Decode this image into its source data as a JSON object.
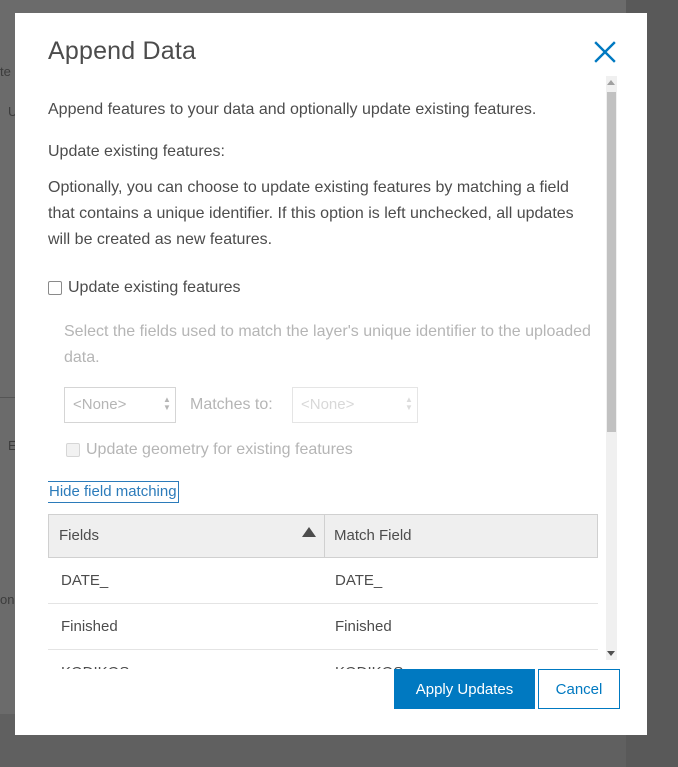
{
  "background": {
    "fragments": [
      "te",
      "U",
      "E",
      "on"
    ]
  },
  "dialog": {
    "title": "Append Data",
    "intro": "Append features to your data and optionally update existing features.",
    "subheading": "Update existing features:",
    "description": "Optionally, you can choose to update existing features by matching a field that contains a unique identifier. If this option is left unchecked, all updates will be created as new features.",
    "update_checkbox": {
      "label": "Update existing features",
      "checked": false
    },
    "select_hint": "Select the fields used to match the layer's unique identifier to the uploaded data.",
    "left_select": {
      "value": "<None>"
    },
    "matches_label": "Matches to:",
    "right_select": {
      "value": "<None>"
    },
    "geometry_checkbox": {
      "label": "Update geometry for existing features",
      "checked": false
    },
    "hide_link": "Hide field matching",
    "table": {
      "headers": [
        "Fields",
        "Match Field"
      ],
      "rows": [
        [
          "DATE_",
          "DATE_"
        ],
        [
          "Finished",
          "Finished"
        ],
        [
          "KODIKOS",
          "KODIKOS"
        ]
      ]
    },
    "buttons": {
      "apply": "Apply Updates",
      "cancel": "Cancel"
    }
  },
  "colors": {
    "accent": "#0079c1",
    "link": "#2b7bba"
  },
  "icons": {
    "close": "close-icon",
    "sort": "sort-ascending-icon"
  }
}
